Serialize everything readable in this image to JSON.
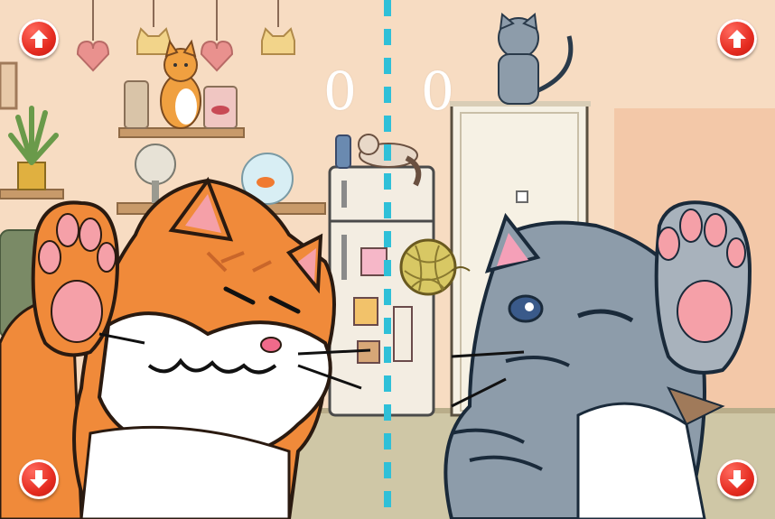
{
  "scores": {
    "left": "0",
    "right": "0"
  },
  "controls": {
    "left_up_icon": "arrow-up-icon",
    "right_up_icon": "arrow-up-icon",
    "left_down_icon": "arrow-down-icon",
    "right_down_icon": "arrow-down-icon",
    "button_color": "#e52b20"
  },
  "colors": {
    "wall": "#f7dcc2",
    "divider": "#2fc0d8",
    "orange_cat": "#f08a3a",
    "grey_cat": "#8d9caa",
    "yarn": "#d8c864"
  },
  "players": {
    "left": "orange-cat",
    "right": "grey-cat"
  }
}
